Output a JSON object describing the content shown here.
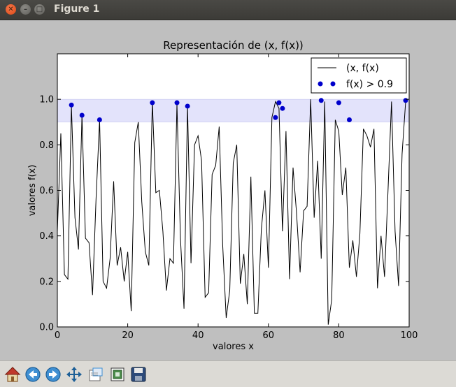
{
  "window": {
    "title": "Figure 1"
  },
  "toolbar": {
    "tools": [
      {
        "name": "home-icon"
      },
      {
        "name": "back-icon"
      },
      {
        "name": "forward-icon"
      },
      {
        "name": "pan-icon"
      },
      {
        "name": "zoom-icon"
      },
      {
        "name": "subplots-icon"
      },
      {
        "name": "save-icon"
      }
    ]
  },
  "chart_data": {
    "type": "line",
    "title": "Representación de (x, f(x))",
    "xlabel": "valores x",
    "ylabel": "valores f(x)",
    "xlim": [
      0,
      100
    ],
    "ylim": [
      0,
      1.2
    ],
    "xticks": [
      "0",
      "20",
      "40",
      "60",
      "80",
      "100"
    ],
    "yticks": [
      "0.0",
      "0.2",
      "0.4",
      "0.6",
      "0.8",
      "1.0"
    ],
    "band": {
      "from": 0.9,
      "to": 1.0,
      "color": "#e3e3fb"
    },
    "legend": {
      "position": "top-right",
      "entries": [
        "(x, f(x)",
        "f(x) > 0.9"
      ]
    },
    "series": [
      {
        "name": "(x, f(x)",
        "style": "line",
        "color": "#000000",
        "x": [
          0,
          1,
          2,
          3,
          4,
          5,
          6,
          7,
          8,
          9,
          10,
          11,
          12,
          13,
          14,
          15,
          16,
          17,
          18,
          19,
          20,
          21,
          22,
          23,
          24,
          25,
          26,
          27,
          28,
          29,
          30,
          31,
          32,
          33,
          34,
          35,
          36,
          37,
          38,
          39,
          40,
          41,
          42,
          43,
          44,
          45,
          46,
          47,
          48,
          49,
          50,
          51,
          52,
          53,
          54,
          55,
          56,
          57,
          58,
          59,
          60,
          61,
          62,
          63,
          64,
          65,
          66,
          67,
          68,
          69,
          70,
          71,
          72,
          73,
          74,
          75,
          76,
          77,
          78,
          79,
          80,
          81,
          82,
          83,
          84,
          85,
          86,
          87,
          88,
          89,
          90,
          91,
          92,
          93,
          94,
          95,
          96,
          97,
          98,
          99
        ],
        "y": [
          0.42,
          0.85,
          0.23,
          0.21,
          0.97,
          0.48,
          0.34,
          0.93,
          0.39,
          0.37,
          0.14,
          0.56,
          0.91,
          0.2,
          0.17,
          0.3,
          0.64,
          0.27,
          0.35,
          0.2,
          0.33,
          0.07,
          0.81,
          0.9,
          0.55,
          0.33,
          0.27,
          0.99,
          0.59,
          0.6,
          0.42,
          0.16,
          0.3,
          0.28,
          0.98,
          0.39,
          0.08,
          0.97,
          0.28,
          0.8,
          0.84,
          0.73,
          0.13,
          0.15,
          0.67,
          0.71,
          0.88,
          0.36,
          0.04,
          0.16,
          0.72,
          0.8,
          0.19,
          0.32,
          0.1,
          0.66,
          0.06,
          0.06,
          0.43,
          0.6,
          0.26,
          0.92,
          0.99,
          0.96,
          0.42,
          0.86,
          0.21,
          0.7,
          0.5,
          0.24,
          0.51,
          0.53,
          1.0,
          0.48,
          0.73,
          0.3,
          0.99,
          0.01,
          0.12,
          0.91,
          0.86,
          0.58,
          0.7,
          0.26,
          0.38,
          0.22,
          0.41,
          0.87,
          0.84,
          0.79,
          0.87,
          0.17,
          0.4,
          0.22,
          0.6,
          0.99,
          0.42,
          0.18,
          0.76,
          0.99
        ]
      },
      {
        "name": "f(x) > 0.9",
        "style": "markers",
        "color": "#0000cc",
        "x": [
          4,
          7,
          12,
          27,
          34,
          37,
          62,
          63,
          64,
          75,
          80,
          83,
          99
        ],
        "y": [
          0.975,
          0.93,
          0.91,
          0.985,
          0.985,
          0.97,
          0.92,
          0.985,
          0.96,
          0.995,
          0.985,
          0.91,
          0.995
        ]
      }
    ]
  }
}
